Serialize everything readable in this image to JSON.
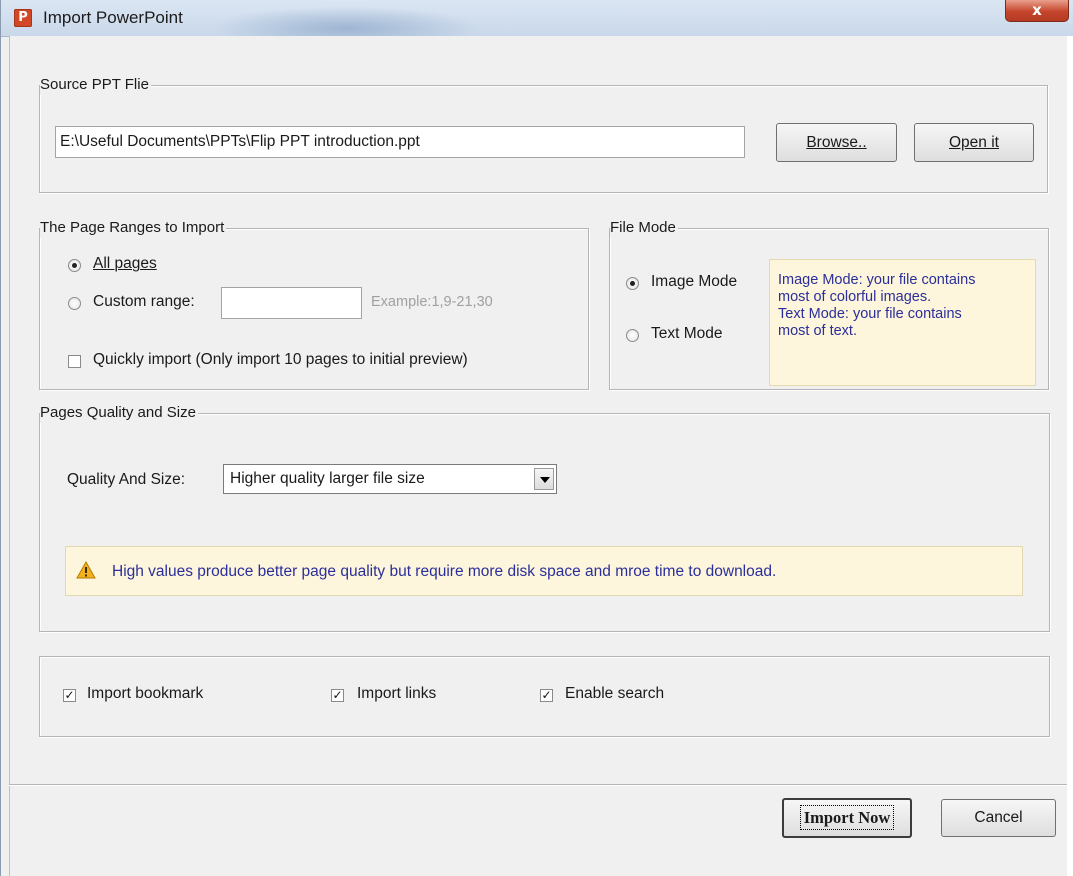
{
  "window": {
    "title": "Import PowerPoint",
    "app_icon_letter": "P",
    "close_glyph": "x"
  },
  "source": {
    "legend": "Source PPT Flie",
    "path_value": "E:\\Useful Documents\\PPTs\\Flip PPT introduction.ppt",
    "browse_label": "Browse..",
    "open_label": "Open it"
  },
  "ranges": {
    "legend": "The Page Ranges to Import",
    "all_pages_label": "All pages",
    "all_pages_selected": true,
    "custom_range_label": "Custom range:",
    "custom_range_value": "",
    "custom_example": "Example:1,9-21,30",
    "quick_import_label": "Quickly import (Only import 10 pages to  initial  preview)",
    "quick_import_checked": false
  },
  "file_mode": {
    "legend": "File Mode",
    "image_mode_label": "Image Mode",
    "image_mode_selected": true,
    "text_mode_label": "Text Mode",
    "info_line1": "Image Mode: your file contains",
    "info_line2": "most of colorful images.",
    "info_line3": "Text Mode: your file contains",
    "info_line4": "most of text."
  },
  "quality": {
    "legend": "Pages Quality and Size",
    "label": "Quality And Size:",
    "selected_option": "Higher quality larger file size",
    "warning_text": "High values produce better page quality but require more disk space and mroe time to download."
  },
  "options": {
    "import_bookmark_label": "Import bookmark",
    "import_bookmark_checked": true,
    "import_links_label": "Import links",
    "import_links_checked": true,
    "enable_search_label": "Enable search",
    "enable_search_checked": true
  },
  "footer": {
    "import_now_label": "Import Now",
    "cancel_label": "Cancel"
  },
  "colors": {
    "info_text": "#2b2f9a",
    "info_bg": "#fdf5dc",
    "dialog_bg": "#f0f0f0",
    "close_button": "#c6452c"
  },
  "icons": {
    "app": "powerpoint-icon",
    "close": "close-icon",
    "warning": "warning-triangle-icon",
    "dropdown": "chevron-down-icon"
  }
}
